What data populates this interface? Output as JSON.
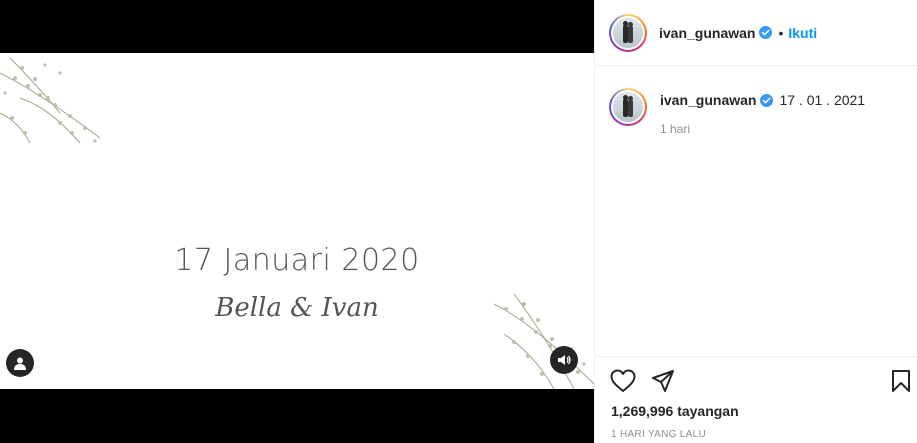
{
  "video": {
    "date_text": "17 Januari 2020",
    "names_text": "Bella & Ivan"
  },
  "header": {
    "username": "ivan_gunawan",
    "dot": "•",
    "follow_label": "Ikuti"
  },
  "caption": {
    "username": "ivan_gunawan",
    "text": "17 . 01 . 2021",
    "time": "1 hari"
  },
  "stats": {
    "views_count": "1,269,996",
    "views_label": "tayangan",
    "posted": "1 HARI YANG LALU"
  },
  "colors": {
    "accent": "#0095f6",
    "verified": "#3897f0",
    "text": "#262626",
    "muted": "#8e8e8e"
  },
  "icons": [
    "user-icon",
    "sound-icon",
    "verified-icon",
    "heart-icon",
    "share-icon",
    "bookmark-icon"
  ]
}
